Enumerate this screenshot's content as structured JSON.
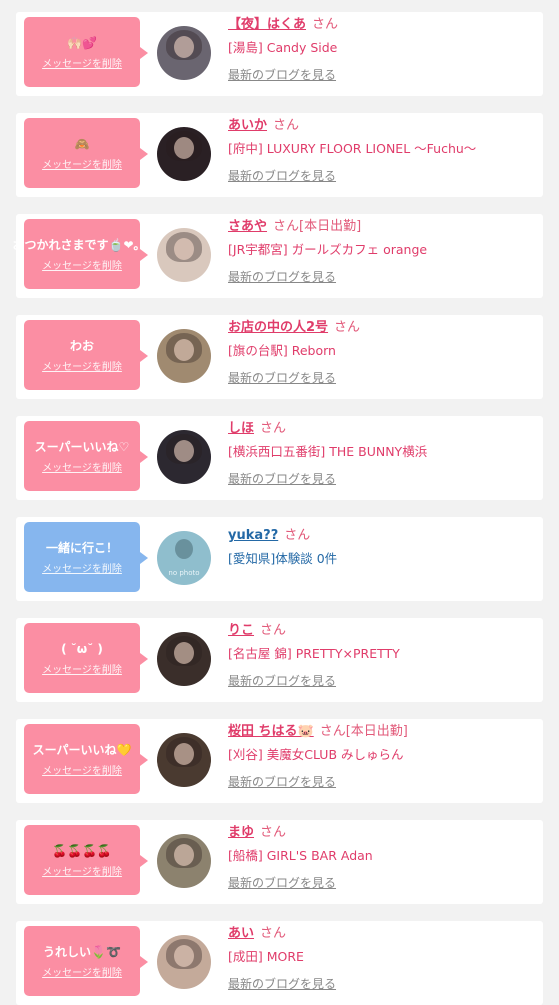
{
  "delete_label": "メッセージを削除",
  "blog_label": "最新のブログを見る",
  "san_label": "さん",
  "colors": {
    "pink_bubble": "#fb8ea3",
    "blue_bubble": "#86b6ee",
    "name_pink": "#e03c6a",
    "name_blue": "#2469a6"
  },
  "items": [
    {
      "message": "🙌🏻💕",
      "color": "pink",
      "name": "【夜】はくあ",
      "tag": "",
      "shop": "[湯島] Candy Side",
      "has_blog": true,
      "avatar_bg": "#6a6570",
      "avatar_icon": "avatar-photo"
    },
    {
      "message": "🙈",
      "color": "pink",
      "name": "あいか",
      "tag": "",
      "shop": "[府中] LUXURY FLOOR LIONEL 〜Fuchu〜",
      "has_blog": true,
      "avatar_bg": "#2a2024",
      "avatar_icon": "avatar-photo"
    },
    {
      "message": "おつかれさまです🍵❤︎｡･ﾟ",
      "color": "pink",
      "name": "さあや",
      "tag": "[本日出勤]",
      "shop": "[JR宇都宮] ガールズカフェ orange",
      "has_blog": true,
      "avatar_bg": "#d9c8bd",
      "avatar_icon": "avatar-photo"
    },
    {
      "message": "わお",
      "color": "pink",
      "name": "お店の中の人2号",
      "tag": "",
      "shop": "[旗の台駅] Reborn",
      "has_blog": true,
      "avatar_bg": "#a08a70",
      "avatar_icon": "dog-photo"
    },
    {
      "message": "スーパーいいね♡",
      "color": "pink",
      "name": "しほ",
      "tag": "",
      "shop": "[横浜西口五番街] THE BUNNY横浜",
      "has_blog": true,
      "avatar_bg": "#2c2830",
      "avatar_icon": "avatar-photo"
    },
    {
      "message": "一緒に行こ！",
      "color": "blue",
      "name": "yuka??",
      "tag": "",
      "shop": "[愛知県]体験談 0件",
      "has_blog": false,
      "avatar_bg": "#8fbecd",
      "avatar_icon": "no-photo",
      "avatar_text": "no photo"
    },
    {
      "message": "( ˘ω˘ )",
      "color": "pink",
      "name": "りこ",
      "tag": "",
      "shop": "[名古屋 錦] PRETTY×PRETTY",
      "has_blog": true,
      "avatar_bg": "#3a2e2a",
      "avatar_icon": "avatar-photo"
    },
    {
      "message": "スーパーいいね💛",
      "color": "pink",
      "name": "桜田 ちはる🐷",
      "tag": "[本日出勤]",
      "shop": "[刈谷] 美魔女CLUB みしゅらん",
      "has_blog": true,
      "avatar_bg": "#4a3a30",
      "avatar_icon": "avatar-photo"
    },
    {
      "message": "🍒🍒🍒🍒",
      "color": "pink",
      "name": "まゆ",
      "tag": "",
      "shop": "[船橋] GIRL'S BAR Adan",
      "has_blog": true,
      "avatar_bg": "#8c826e",
      "avatar_icon": "meerkat-photo"
    },
    {
      "message": "うれしい🌷➰",
      "color": "pink",
      "name": "あい",
      "tag": "",
      "shop": "[成田] MORE",
      "has_blog": true,
      "avatar_bg": "#c4aa9a",
      "avatar_icon": "avatar-photo"
    }
  ]
}
